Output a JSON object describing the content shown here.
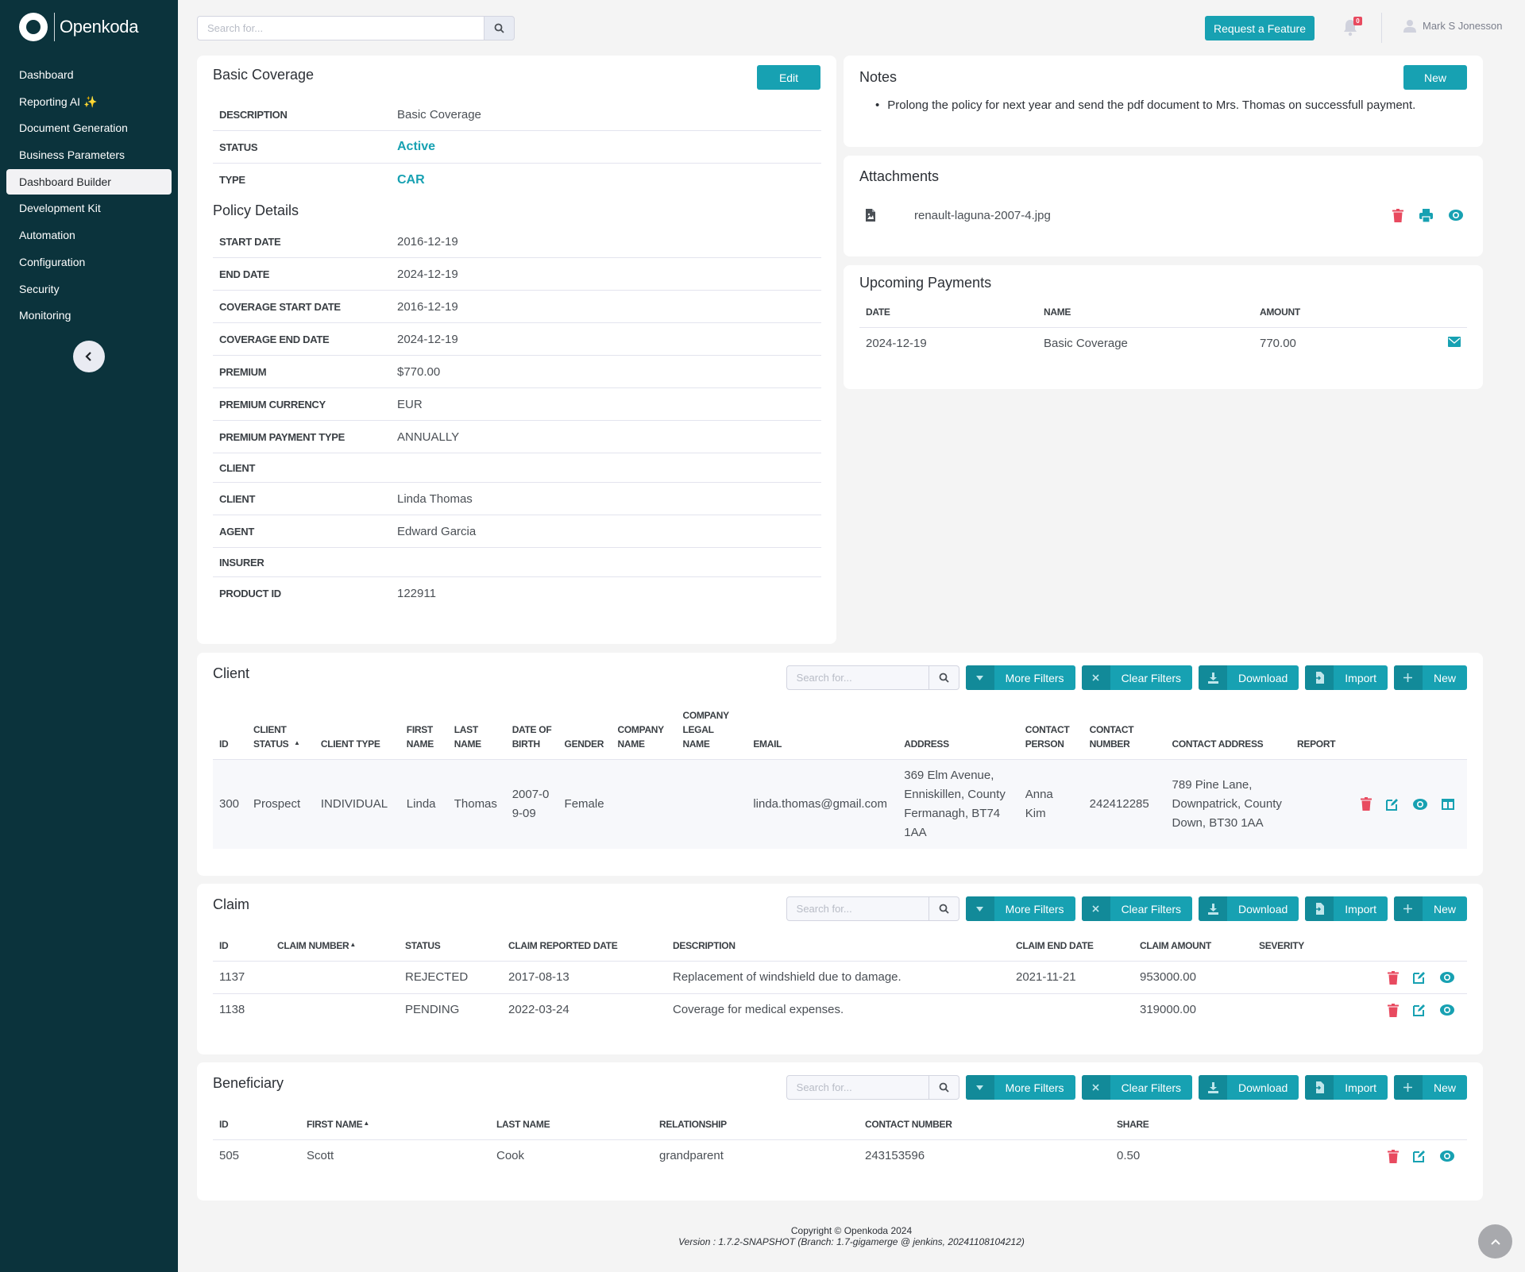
{
  "app": {
    "name": "Openkoda"
  },
  "sidebar": {
    "items": [
      {
        "label": "Dashboard",
        "active": false
      },
      {
        "label": "Reporting AI ✨",
        "active": false
      },
      {
        "label": "Document Generation",
        "active": false
      },
      {
        "label": "Business Parameters",
        "active": false
      },
      {
        "label": "Dashboard Builder",
        "active": true
      },
      {
        "label": "Development Kit",
        "active": false
      },
      {
        "label": "Automation",
        "active": false
      },
      {
        "label": "Configuration",
        "active": false
      },
      {
        "label": "Security",
        "active": false
      },
      {
        "label": "Monitoring",
        "active": false
      }
    ],
    "collapse_icon": "chevron-left-icon"
  },
  "topbar": {
    "search_placeholder": "Search for...",
    "request_feature_label": "Request a Feature",
    "notification_count": "0",
    "user_name": "Mark S Jonesson"
  },
  "policy": {
    "title": "Basic Coverage",
    "edit_label": "Edit",
    "summary": [
      {
        "label": "DESCRIPTION",
        "value": "Basic Coverage",
        "link": false
      },
      {
        "label": "STATUS",
        "value": "Active",
        "link": true
      },
      {
        "label": "TYPE",
        "value": "CAR",
        "link": true
      }
    ],
    "details_title": "Policy Details",
    "details": [
      {
        "label": "START DATE",
        "value": "2016-12-19"
      },
      {
        "label": "END DATE",
        "value": "2024-12-19"
      },
      {
        "label": "COVERAGE START DATE",
        "value": "2016-12-19"
      },
      {
        "label": "COVERAGE END DATE",
        "value": "2024-12-19"
      },
      {
        "label": "PREMIUM",
        "value": "$770.00"
      },
      {
        "label": "PREMIUM CURRENCY",
        "value": "EUR"
      },
      {
        "label": "PREMIUM PAYMENT TYPE",
        "value": "ANNUALLY"
      },
      {
        "label": "CLIENT",
        "value": ""
      },
      {
        "label": "CLIENT",
        "value": "Linda Thomas"
      },
      {
        "label": "AGENT",
        "value": "Edward Garcia"
      },
      {
        "label": "INSURER",
        "value": ""
      },
      {
        "label": "PRODUCT ID",
        "value": "122911"
      }
    ]
  },
  "notes": {
    "title": "Notes",
    "new_label": "New",
    "items": [
      "Prolong the policy for next year and send the pdf document to Mrs. Thomas on successfull payment."
    ]
  },
  "attachments": {
    "title": "Attachments",
    "items": [
      {
        "name": "renault-laguna-2007-4.jpg"
      }
    ]
  },
  "payments": {
    "title": "Upcoming Payments",
    "columns": [
      "DATE",
      "NAME",
      "AMOUNT"
    ],
    "rows": [
      {
        "date": "2024-12-19",
        "name": "Basic Coverage",
        "amount": "770.00"
      }
    ]
  },
  "toolbar": {
    "search_placeholder": "Search for...",
    "more_filters": "More Filters",
    "clear_filters": "Clear Filters",
    "download": "Download",
    "import": "Import",
    "new": "New"
  },
  "client": {
    "title": "Client",
    "columns": [
      "ID",
      "CLIENT STATUS",
      "CLIENT TYPE",
      "FIRST NAME",
      "LAST NAME",
      "DATE OF BIRTH",
      "GENDER",
      "COMPANY NAME",
      "COMPANY LEGAL NAME",
      "EMAIL",
      "ADDRESS",
      "CONTACT PERSON",
      "CONTACT NUMBER",
      "CONTACT ADDRESS",
      "REPORT"
    ],
    "sorted_column": "CLIENT STATUS",
    "rows": [
      {
        "id": "300",
        "status": "Prospect",
        "type": "INDIVIDUAL",
        "first_name": "Linda",
        "last_name": "Thomas",
        "dob": "2007-09-09",
        "gender": "Female",
        "company_name": "",
        "company_legal_name": "",
        "email": "linda.thomas@gmail.com",
        "address": "369 Elm Avenue, Enniskillen, County Fermanagh, BT74 1AA",
        "contact_person": "Anna Kim",
        "contact_number": "242412285",
        "contact_address": "789 Pine Lane, Downpatrick, County Down, BT30 1AA",
        "report": ""
      }
    ]
  },
  "claim": {
    "title": "Claim",
    "columns": [
      "ID",
      "CLAIM NUMBER",
      "STATUS",
      "CLAIM REPORTED DATE",
      "DESCRIPTION",
      "CLAIM END DATE",
      "CLAIM AMOUNT",
      "SEVERITY"
    ],
    "sorted_column": "CLAIM NUMBER",
    "rows": [
      {
        "id": "1137",
        "number": "",
        "status": "REJECTED",
        "reported": "2017-08-13",
        "description": "Replacement of windshield due to damage.",
        "end_date": "2021-11-21",
        "amount": "953000.00",
        "severity": ""
      },
      {
        "id": "1138",
        "number": "",
        "status": "PENDING",
        "reported": "2022-03-24",
        "description": "Coverage for medical expenses.",
        "end_date": "",
        "amount": "319000.00",
        "severity": ""
      }
    ]
  },
  "beneficiary": {
    "title": "Beneficiary",
    "columns": [
      "ID",
      "FIRST NAME",
      "LAST NAME",
      "RELATIONSHIP",
      "CONTACT NUMBER",
      "SHARE"
    ],
    "sorted_column": "FIRST NAME",
    "rows": [
      {
        "id": "505",
        "first_name": "Scott",
        "last_name": "Cook",
        "relationship": "grandparent",
        "contact_number": "243153596",
        "share": "0.50"
      }
    ]
  },
  "footer": {
    "copyright": "Copyright © Openkoda 2024",
    "version": "Version : 1.7.2-SNAPSHOT (Branch: 1.7-gigamerge @ jenkins, 20241108104212)"
  },
  "colors": {
    "accent": "#17a1b2",
    "danger": "#e84a5f",
    "sidebar": "#0b333c"
  }
}
